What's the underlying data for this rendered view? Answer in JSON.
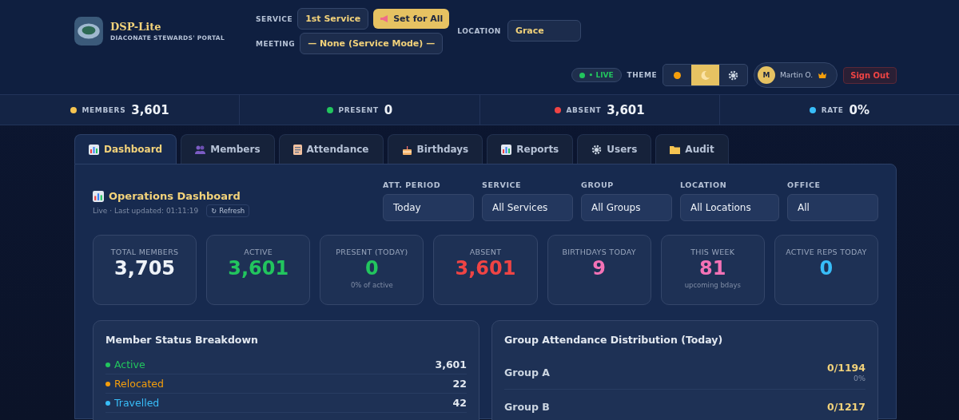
{
  "brand": {
    "title": "DSP-Lite",
    "subtitle": "DIACONATE STEWARDS' PORTAL"
  },
  "controls": {
    "service_label": "SERVICE",
    "service": "1st Service",
    "set_all": "Set for All",
    "meeting_label": "MEETING",
    "meeting": "— None (Service Mode) —",
    "location_label": "LOCATION",
    "location": "Grace"
  },
  "status": {
    "live": "• LIVE",
    "theme_label": "THEME",
    "themes": [
      {
        "kind": "sun",
        "selected": false
      },
      {
        "kind": "moon",
        "selected": true
      },
      {
        "kind": "gear",
        "selected": false
      }
    ],
    "avatar": "M",
    "user": "Martin O.",
    "sign_out": "Sign Out"
  },
  "summary": [
    {
      "label": "MEMBERS",
      "value": "3,601",
      "color": "#f5c451"
    },
    {
      "label": "PRESENT",
      "value": "0",
      "color": "#22c55e"
    },
    {
      "label": "ABSENT",
      "value": "3,601",
      "color": "#ef4444"
    },
    {
      "label": "RATE",
      "value": "0%",
      "color": "#38bdf8"
    }
  ],
  "tabs": [
    {
      "label": "Dashboard",
      "kind": "chart",
      "selected": true
    },
    {
      "label": "Members",
      "kind": "people",
      "selected": false
    },
    {
      "label": "Attendance",
      "kind": "clipboard",
      "selected": false
    },
    {
      "label": "Birthdays",
      "kind": "cake",
      "selected": false
    },
    {
      "label": "Reports",
      "kind": "chart",
      "selected": false
    },
    {
      "label": "Users",
      "kind": "gear",
      "selected": false
    },
    {
      "label": "Audit",
      "kind": "folder",
      "selected": false
    }
  ],
  "dashboard": {
    "title": "Operations Dashboard",
    "updated": "Live · Last updated: 01:11:19",
    "refresh": "↻ Refresh",
    "filters": [
      {
        "label": "ATT. PERIOD",
        "value": "Today"
      },
      {
        "label": "SERVICE",
        "value": "All Services"
      },
      {
        "label": "GROUP",
        "value": "All Groups"
      },
      {
        "label": "LOCATION",
        "value": "All Locations"
      },
      {
        "label": "OFFICE",
        "value": "All"
      }
    ],
    "cards": [
      {
        "label": "TOTAL MEMBERS",
        "value": "3,705",
        "color": "#eef2f8"
      },
      {
        "label": "ACTIVE",
        "value": "3,601",
        "color": "#22c55e"
      },
      {
        "label": "PRESENT (TODAY)",
        "value": "0",
        "color": "#22c55e",
        "note": "0% of active"
      },
      {
        "label": "ABSENT",
        "value": "3,601",
        "color": "#ef4444"
      },
      {
        "label": "BIRTHDAYS TODAY",
        "value": "9",
        "color": "#f472b6"
      },
      {
        "label": "THIS WEEK",
        "value": "81",
        "color": "#f472b6",
        "note": "upcoming bdays"
      },
      {
        "label": "ACTIVE REPS TODAY",
        "value": "0",
        "color": "#38bdf8"
      }
    ],
    "breakdown": {
      "title": "Member Status Breakdown",
      "rows": [
        {
          "label": "Active",
          "value": "3,601",
          "color": "#22c55e"
        },
        {
          "label": "Relocated",
          "value": "22",
          "color": "#f59e0b"
        },
        {
          "label": "Travelled",
          "value": "42",
          "color": "#38bdf8"
        }
      ]
    },
    "groups": {
      "title": "Group Attendance Distribution (Today)",
      "rows": [
        {
          "name": "Group A",
          "count": "0/1194",
          "pct": "0%"
        },
        {
          "name": "Group B",
          "count": "0/1217"
        }
      ]
    }
  }
}
